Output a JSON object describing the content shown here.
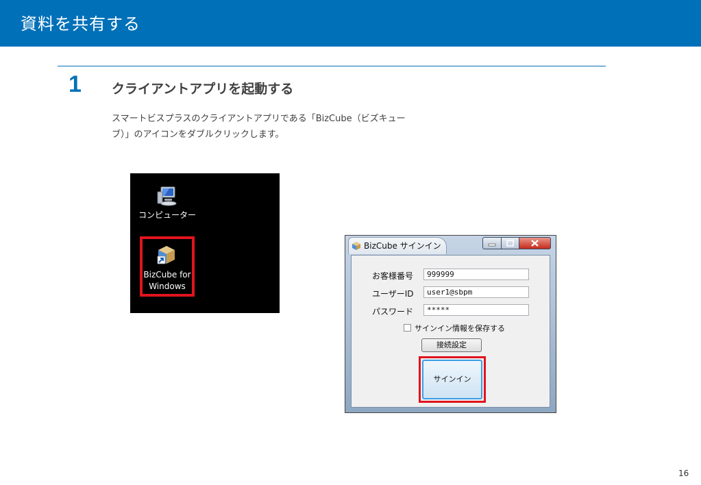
{
  "header": {
    "title": "資料を共有する"
  },
  "step": {
    "number": "1",
    "title": "クライアントアプリを起動する",
    "description_line1": "スマートビスプラスのクライアントアプリである「BizCube（ビズキュー",
    "description_line2": "ブ）」のアイコンをダブルクリックします。"
  },
  "desktop": {
    "computer_icon": "computer-icon",
    "computer_label": "コンピューター",
    "app_icon": "bizcube-app-icon",
    "app_label_line1": "BizCube for",
    "app_label_line2": "Windows",
    "highlight_color": "#e0141e"
  },
  "dialog": {
    "title": "BizCube サインイン",
    "fields": [
      {
        "label": "お客様番号",
        "value": "999999"
      },
      {
        "label": "ユーザーID",
        "value": "user1@sbpm"
      },
      {
        "label": "パスワード",
        "value": "*****"
      }
    ],
    "save_checkbox_label": "サインイン情報を保存する",
    "save_checked": false,
    "connection_button": "接続設定",
    "signin_button": "サインイン"
  },
  "page_number": "16",
  "colors": {
    "brand": "#0070b8",
    "highlight": "#e0141e"
  }
}
